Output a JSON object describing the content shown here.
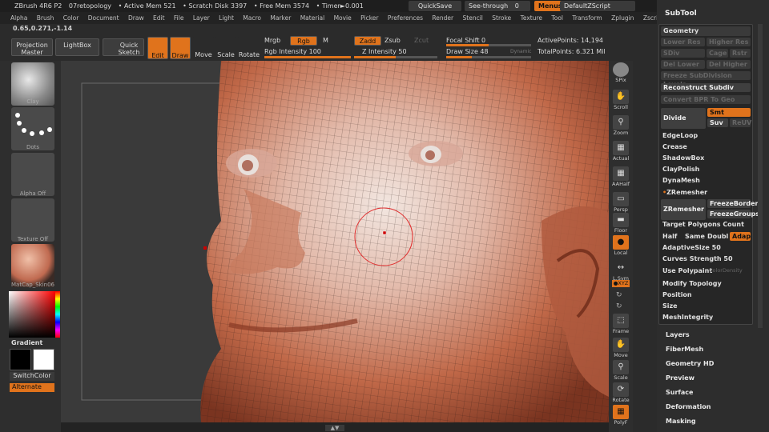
{
  "titlebar": {
    "app": "ZBrush 4R6 P2",
    "doc": "07retopology",
    "active_mem": "• Active Mem 521",
    "scratch": "• Scratch Disk 3397",
    "free_mem": "• Free Mem 3574",
    "timer": "• Timer►0.001",
    "quicksave": "QuickSave",
    "seethrough": "See-through",
    "seethrough_val": "0",
    "menus": "Menus",
    "script": "DefaultZScript"
  },
  "menubar": [
    "Alpha",
    "Brush",
    "Color",
    "Document",
    "Draw",
    "Edit",
    "File",
    "Layer",
    "Light",
    "Macro",
    "Marker",
    "Material",
    "Movie",
    "Picker",
    "Preferences",
    "Render",
    "Stencil",
    "Stroke",
    "Texture",
    "Tool",
    "Transform",
    "Zplugin",
    "Zscript"
  ],
  "coords": "0.65,0.271,-1.14",
  "toolbar": {
    "projection_master": "Projection Master",
    "lightbox": "LightBox",
    "quick_sketch": "Quick Sketch",
    "edit": "Edit",
    "draw": "Draw",
    "move": "Move",
    "scale": "Scale",
    "rotate": "Rotate",
    "mrgb": "Mrgb",
    "rgb": "Rgb",
    "m": "M",
    "rgb_intensity_label": "Rgb Intensity",
    "rgb_intensity": "100",
    "rgb_intensity_value": 1.0,
    "zadd": "Zadd",
    "zsub": "Zsub",
    "zcut": "Zcut",
    "z_intensity_label": "Z Intensity",
    "z_intensity": "50",
    "z_intensity_value": 0.5,
    "focal_shift_label": "Focal Shift",
    "focal_shift": "0",
    "focal_shift_value": 0.5,
    "draw_size_label": "Draw Size",
    "draw_size": "48",
    "draw_size_value": 0.3,
    "dynamic": "Dynamic",
    "active_points_label": "ActivePoints:",
    "active_points": "14,194",
    "total_points_label": "TotalPoints:",
    "total_points": "6.321 Mil"
  },
  "leftshelf": {
    "clay": "Clay",
    "dots": "Dots",
    "alpha": "Alpha Off",
    "texture": "Texture Off",
    "matcap": "MatCap_Skin06",
    "gradient": "Gradient",
    "switchcolor": "SwitchColor",
    "alternate": "Alternate"
  },
  "rightshelf": {
    "spix": "SPix",
    "scroll": "Scroll",
    "zoom": "Zoom",
    "actual": "Actual",
    "aahalf": "AAHalf",
    "persp": "Persp",
    "floor": "Floor",
    "local": "Local",
    "lsym": "L.Sym",
    "xyz": "●XYZ",
    "frame": "Frame",
    "move": "Move",
    "scale": "Scale",
    "rotate": "Rotate",
    "polyf": "PolyF"
  },
  "sidebar": {
    "subtool": "SubTool",
    "geometry": "Geometry",
    "lower_res": "Lower Res",
    "higher_res": "Higher Res",
    "sdiv": "SDiv",
    "cage": "Cage",
    "rstr": "Rstr",
    "del_lower": "Del Lower",
    "del_higher": "Del Higher",
    "freeze_subdiv": "Freeze SubDivision Levels",
    "reconstruct": "Reconstruct Subdiv",
    "convert_bpr": "Convert BPR To Geo",
    "divide": "Divide",
    "smt": "Smt",
    "suv": "Suv",
    "reuv": "ReUV",
    "edgeloop": "EdgeLoop",
    "crease": "Crease",
    "shadowbox": "ShadowBox",
    "claypolish": "ClayPolish",
    "dynamesh": "DynaMesh",
    "zremesher_section": "ZRemesher",
    "zremesher_btn": "ZRemesher",
    "freezeborder": "FreezeBorder",
    "freezegroups": "FreezeGroups",
    "target_polys": "Target Polygons Count",
    "half": "Half",
    "same": "Same",
    "double": "Double",
    "adapt": "Adapt",
    "adaptive_size_label": "AdaptiveSize",
    "adaptive_size": "50",
    "curves_strength_label": "Curves Strength",
    "curves_strength": "50",
    "use_polypaint": "Use Polypaint",
    "color_density": "ColorDensity",
    "modify_topology": "Modify Topology",
    "position": "Position",
    "size": "Size",
    "meshintegrity": "MeshIntegrity",
    "layers": "Layers",
    "fibermesh": "FiberMesh",
    "geometry_hd": "Geometry HD",
    "preview": "Preview",
    "surface": "Surface",
    "deformation": "Deformation",
    "masking": "Masking"
  },
  "colors": {
    "accent": "#e0731c",
    "panel": "#2d2d2d",
    "skin": "#c8785a"
  }
}
